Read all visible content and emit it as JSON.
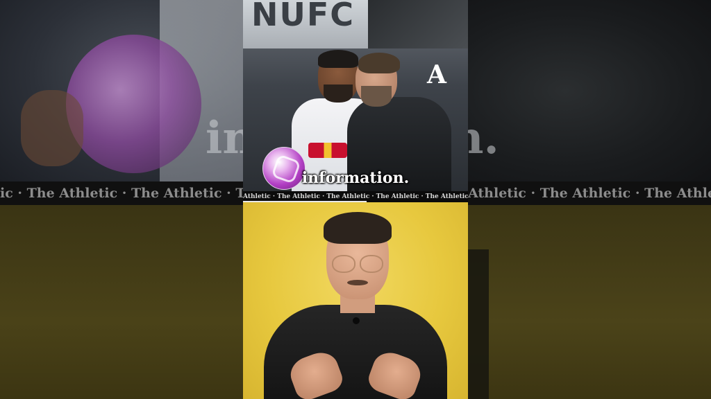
{
  "caption": "information.",
  "ticker_text": "Athletic · The Athletic · The Athletic · The Athletic · The Athletic · The Athletic · The Athletic · The Athletic · The Athletic",
  "ticker_progress": 0.55,
  "logo": "A",
  "background": {
    "big_text_left": "in",
    "big_text_right": "n.",
    "ticker_text_left": "ic · The Athletic · The Athletic · The Athletic",
    "ticker_text_right": "Athletic · The Athletic · The Athletic"
  },
  "scene": {
    "stand_sign_text": "NUFC"
  }
}
